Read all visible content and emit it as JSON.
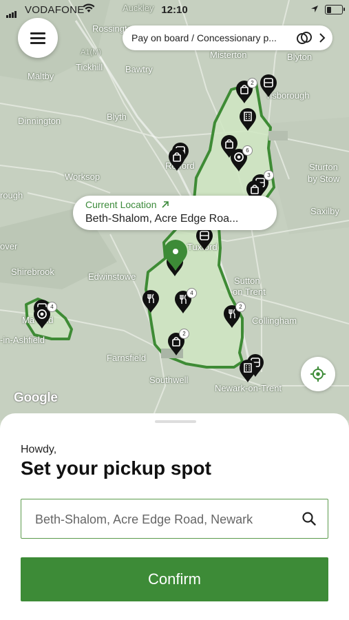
{
  "status": {
    "carrier": "VODAFONE",
    "time": "12:10"
  },
  "header": {
    "menu_icon": "hamburger-menu-icon",
    "payment_label": "Pay on board / Concessionary p...",
    "payment_icon": "payment-rings-icon",
    "chevron_icon": "chevron-right-icon"
  },
  "map": {
    "labels": {
      "auckley": "Auckley",
      "rossington": "Rossington",
      "a1m": "A1(M)",
      "tickhill": "Tickhill",
      "bawtry": "Bawtry",
      "misterton": "Misterton",
      "blyton": "Blyton",
      "maltby": "Maltby",
      "dinnington": "Dinnington",
      "blyth": "Blyth",
      "gainsborough": "nsborough",
      "worksop": "Worksop",
      "retford": "Retford",
      "sturton": "Sturton",
      "by_stow": "by Stow",
      "saxilby": "Saxilby",
      "rough": "rough",
      "tuxford": "Tuxford",
      "over": "over",
      "shirebrook": "Shirebrook",
      "edwinstowe": "Edwinstowe",
      "sutton": "Sutton",
      "on_trent": "on Trent",
      "collingham": "Collingham",
      "mansfield": "Ma     field",
      "in_ashfield": "-in-Ashfield",
      "farnsfield": "Farnsfield",
      "southwell": "Southwell",
      "newark": "Newark-on-Trent"
    },
    "badges": [
      "2",
      "6",
      "3",
      "4",
      "2",
      "4",
      "2"
    ],
    "current_location_label": "Current Location",
    "current_location_address": "Beth-Shalom, Acre Edge Roa...",
    "attribution": "Google",
    "locate_icon": "crosshair-locate-icon"
  },
  "sheet": {
    "greeting": "Howdy,",
    "title": "Set your pickup spot",
    "search_value": "Beth-Shalom, Acre Edge Road, Newark",
    "search_icon": "search-icon",
    "confirm_label": "Confirm"
  },
  "colors": {
    "accent": "#3d8b37",
    "zone_fill": "#cfe6c2",
    "zone_stroke": "#3e8b35"
  }
}
